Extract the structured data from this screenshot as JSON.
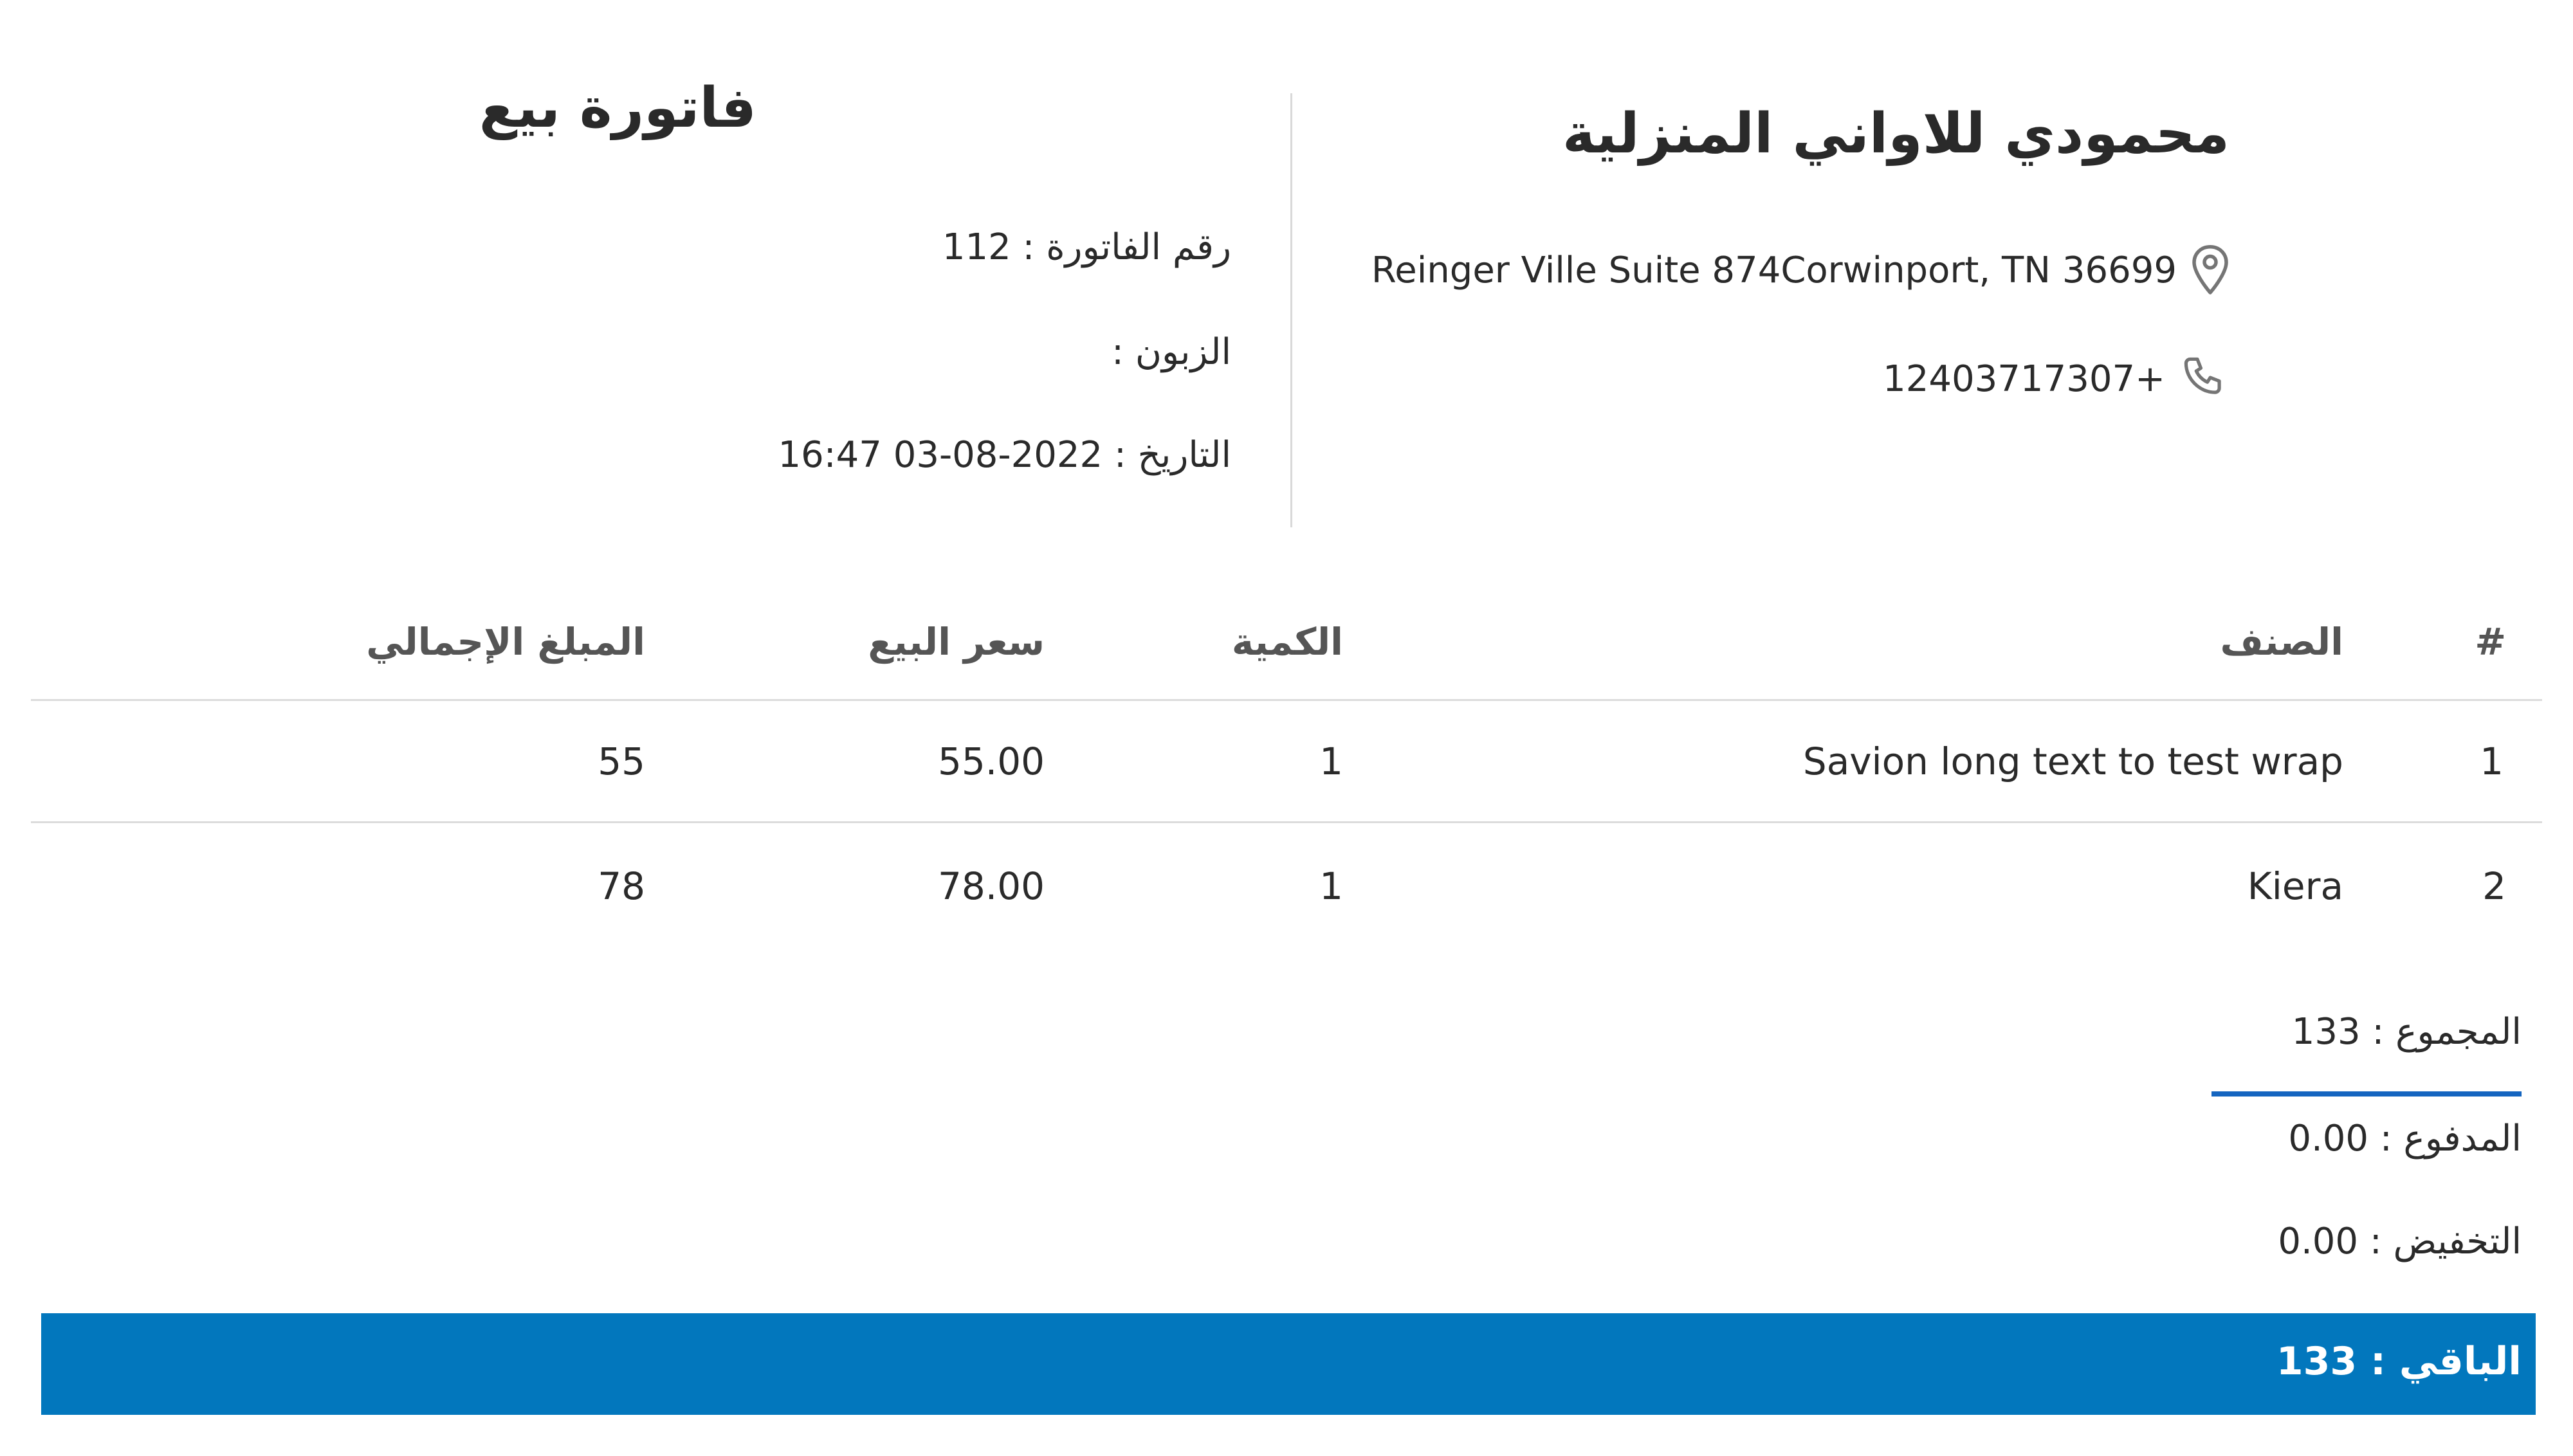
{
  "company": {
    "name": "محمودي للاواني المنزلية",
    "address": "Reinger Ville Suite 874Corwinport, TN 36699",
    "phone": "12403717307+"
  },
  "invoice": {
    "title": "فاتورة بيع",
    "number_line": "رقم الفاتورة : 112",
    "customer_line": "الزبون :",
    "date_label": "التاريخ :",
    "date_value": "16:47 03-08-2022"
  },
  "table": {
    "headers": {
      "index": "#",
      "item": "الصنف",
      "quantity": "الكمية",
      "price": "سعر البيع",
      "total": "المبلغ الإجمالي"
    },
    "rows": [
      {
        "index": "1",
        "item": "Savion long text to test wrap",
        "quantity": "1",
        "price": "55.00",
        "total": "55"
      },
      {
        "index": "2",
        "item": "Kiera",
        "quantity": "1",
        "price": "78.00",
        "total": "78"
      }
    ]
  },
  "totals": {
    "sum_line": "المجموع : 133",
    "paid_line": "المدفوع : 0.00",
    "discount_line": "التخفيض : 0.00",
    "remaining_line": "الباقي : 133"
  },
  "icons": {
    "address": "map-pin-icon",
    "phone": "phone-icon"
  },
  "colors": {
    "accent_bar": "#0277bd",
    "sum_underline": "#1565c0"
  }
}
